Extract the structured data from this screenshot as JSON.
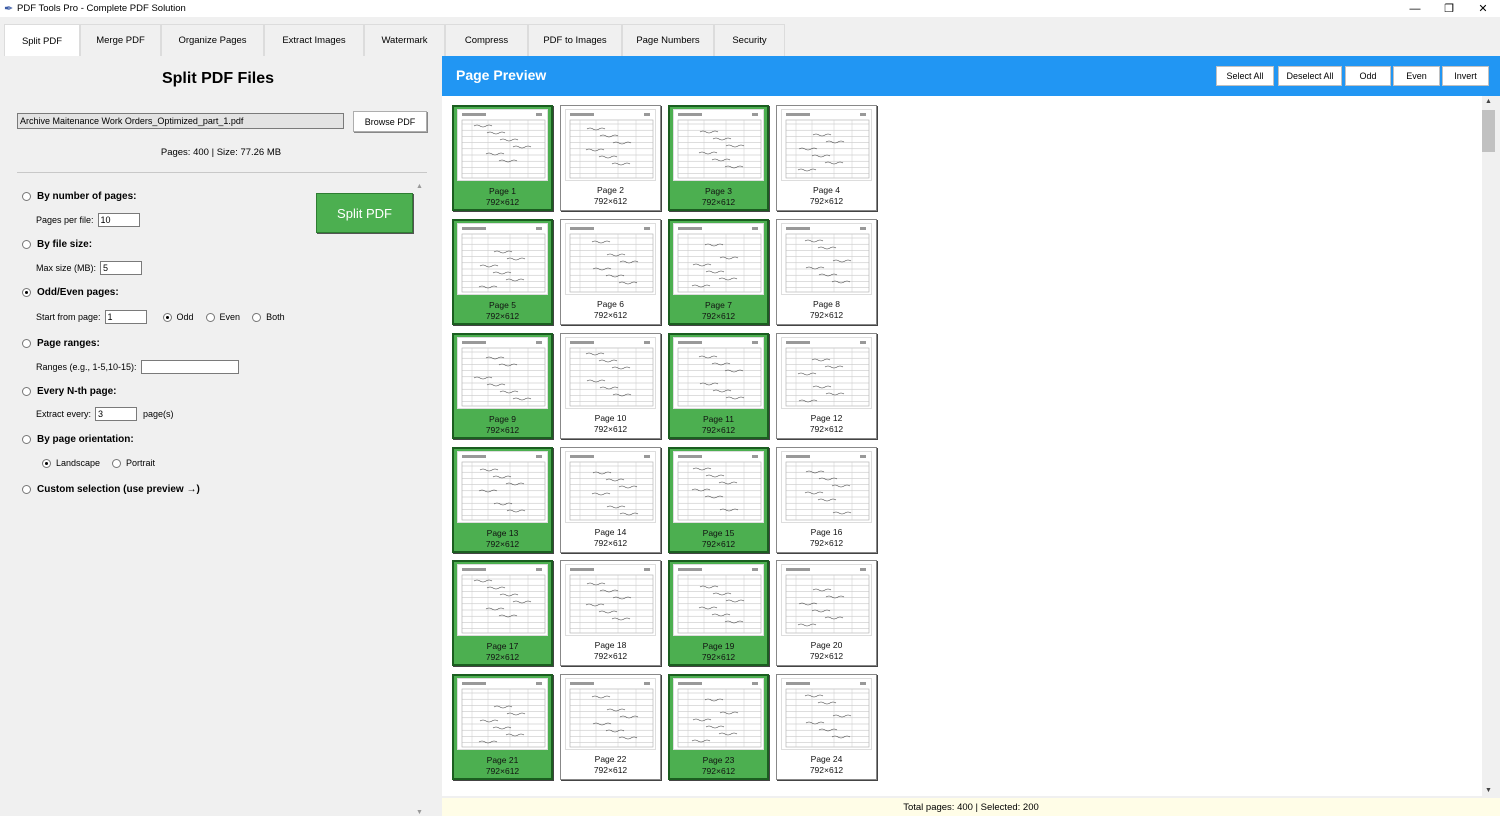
{
  "window": {
    "title": "PDF Tools Pro - Complete PDF Solution",
    "controls": [
      "—",
      "❐",
      "✕"
    ]
  },
  "tabs": [
    {
      "label": "Split PDF",
      "active": true
    },
    {
      "label": "Merge PDF"
    },
    {
      "label": "Organize Pages"
    },
    {
      "label": "Extract Images"
    },
    {
      "label": "Watermark"
    },
    {
      "label": "Compress"
    },
    {
      "label": "PDF to Images"
    },
    {
      "label": "Page Numbers"
    },
    {
      "label": "Security"
    }
  ],
  "split": {
    "title": "Split PDF Files",
    "file_name": "Archive Maitenance Work Orders_Optimized_part_1.pdf",
    "browse_label": "Browse PDF",
    "file_info": "Pages: 400 | Size: 77.26 MB",
    "split_button": "Split PDF",
    "options": {
      "by_pages": {
        "label": "By number of pages:",
        "field_label": "Pages per file:",
        "value": "10"
      },
      "by_size": {
        "label": "By file size:",
        "field_label": "Max size (MB):",
        "value": "5"
      },
      "odd_even": {
        "label": "Odd/Even pages:",
        "field_label": "Start from page:",
        "value": "1",
        "choices": [
          "Odd",
          "Even",
          "Both"
        ],
        "selected_choice": "Odd"
      },
      "ranges": {
        "label": "Page ranges:",
        "field_label": "Ranges (e.g., 1-5,10-15):",
        "value": ""
      },
      "every_nth": {
        "label": "Every N-th page:",
        "field_label": "Extract every:",
        "value": "3",
        "suffix": "page(s)"
      },
      "orientation": {
        "label": "By page orientation:",
        "choices": [
          "Landscape",
          "Portrait"
        ],
        "selected_choice": "Landscape"
      },
      "custom": {
        "label": "Custom selection (use preview →)"
      }
    },
    "selected_option": "odd_even"
  },
  "preview": {
    "title": "Page Preview",
    "buttons": [
      "Select All",
      "Deselect All",
      "Odd",
      "Even",
      "Invert"
    ],
    "page_size": "792×612",
    "pages": [
      {
        "label": "Page 1",
        "selected": true
      },
      {
        "label": "Page 2",
        "selected": false
      },
      {
        "label": "Page 3",
        "selected": true
      },
      {
        "label": "Page 4",
        "selected": false
      },
      {
        "label": "Page 5",
        "selected": true
      },
      {
        "label": "Page 6",
        "selected": false
      },
      {
        "label": "Page 7",
        "selected": true
      },
      {
        "label": "Page 8",
        "selected": false
      },
      {
        "label": "Page 9",
        "selected": true
      },
      {
        "label": "Page 10",
        "selected": false
      },
      {
        "label": "Page 11",
        "selected": true
      },
      {
        "label": "Page 12",
        "selected": false
      },
      {
        "label": "Page 13",
        "selected": true
      },
      {
        "label": "Page 14",
        "selected": false
      },
      {
        "label": "Page 15",
        "selected": true
      },
      {
        "label": "Page 16",
        "selected": false
      },
      {
        "label": "Page 17",
        "selected": true
      },
      {
        "label": "Page 18",
        "selected": false
      },
      {
        "label": "Page 19",
        "selected": true
      },
      {
        "label": "Page 20",
        "selected": false
      },
      {
        "label": "Page 21",
        "selected": true
      },
      {
        "label": "Page 22",
        "selected": false
      },
      {
        "label": "Page 23",
        "selected": true
      },
      {
        "label": "Page 24",
        "selected": false
      }
    ]
  },
  "status": "Total pages: 400 | Selected: 200"
}
